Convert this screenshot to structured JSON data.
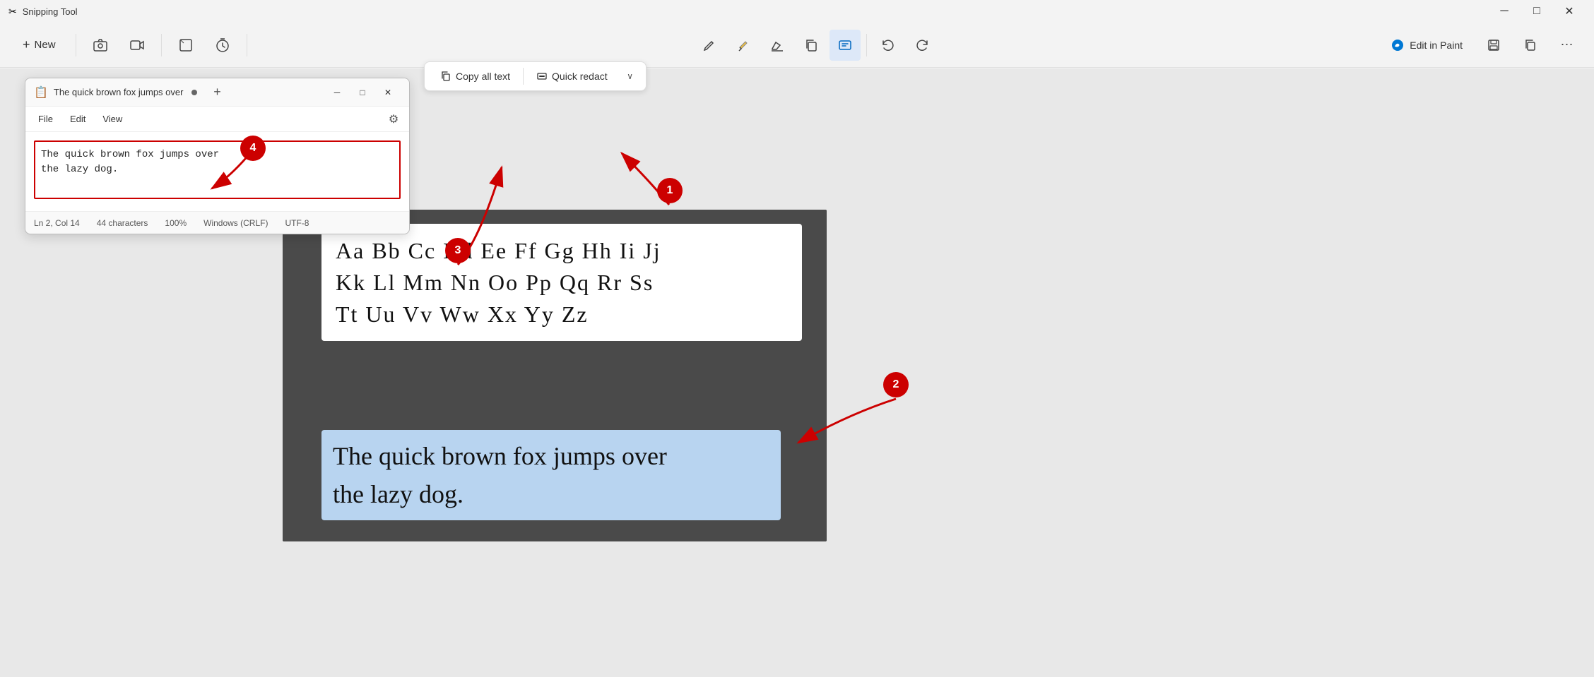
{
  "app": {
    "title": "Snipping Tool",
    "icon": "✂"
  },
  "title_bar": {
    "title": "Snipping Tool",
    "min_label": "─",
    "max_label": "□",
    "close_label": "✕"
  },
  "main_toolbar": {
    "new_label": "New",
    "new_icon": "+",
    "camera_icon": "📷",
    "video_icon": "🎬",
    "shape_icon": "□",
    "timer_icon": "⏱",
    "pen_icon": "✏",
    "highlighter_icon": "🖊",
    "eraser_icon": "◻",
    "copy_icon": "⧉",
    "crop_icon": "⛶",
    "ocr_icon": "≡",
    "undo_icon": "↩",
    "redo_icon": "↪",
    "edit_paint_label": "Edit in Paint",
    "save_icon": "💾",
    "copy2_icon": "⧉",
    "more_icon": "⋯"
  },
  "action_toolbar": {
    "copy_all_text_label": "Copy all text",
    "copy_icon": "⧉",
    "quick_redact_label": "Quick redact",
    "redact_icon": "✎",
    "chevron_icon": "∨"
  },
  "notepad": {
    "tab_icon": "📋",
    "tab_label": "The quick brown fox jumps over",
    "add_icon": "+",
    "min_label": "─",
    "max_label": "□",
    "close_label": "✕",
    "menu": {
      "file": "File",
      "edit": "Edit",
      "view": "View"
    },
    "settings_icon": "⚙",
    "content": "The quick brown fox jumps over\nthe lazy dog.",
    "status": {
      "position": "Ln 2, Col 14",
      "characters": "44 characters",
      "zoom": "100%",
      "line_endings": "Windows (CRLF)",
      "encoding": "UTF-8"
    }
  },
  "annotations": {
    "circle1_label": "1",
    "circle2_label": "2",
    "circle3_label": "3",
    "circle4_label": "4"
  },
  "image": {
    "alphabet_line1": "Aa Bb Cc Dd Ee Ff Gg Hh Ii Jj",
    "alphabet_line2": "Kk Ll Mm Nn Oo Pp Qq Rr Ss",
    "alphabet_line3": "Tt Uu Vv Ww Xx Yy Zz",
    "highlighted_line1": "The quick brown fox jumps over",
    "highlighted_line2": "the lazy dog."
  }
}
